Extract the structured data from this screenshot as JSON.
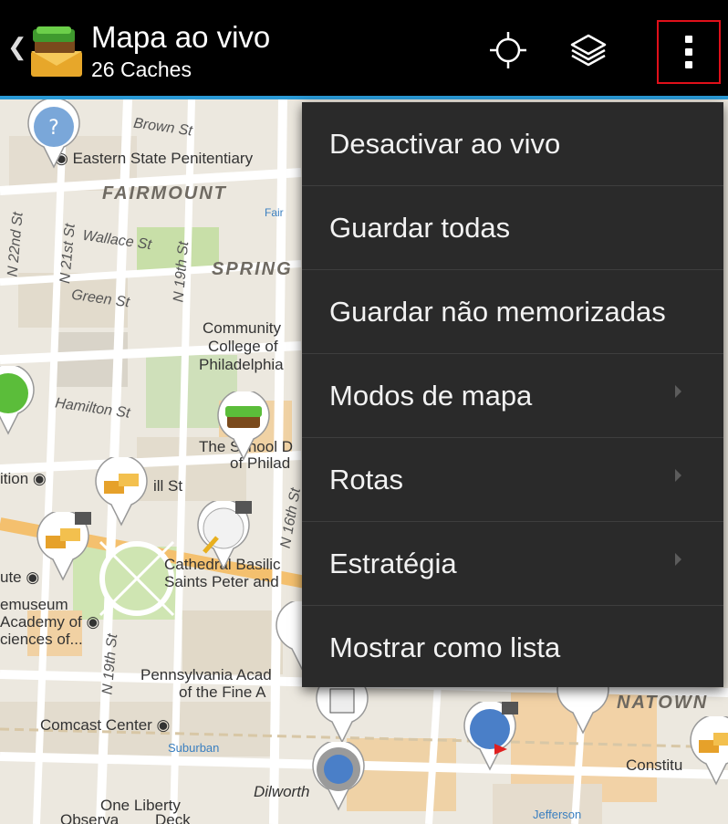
{
  "appbar": {
    "title": "Mapa ao vivo",
    "subtitle": "26 Caches",
    "icons": {
      "back": "back-chevron-icon",
      "logo": "app-logo-icon",
      "locate": "my-location-crosshair-icon",
      "layers": "layers-icon",
      "overflow": "more-vertical-icon"
    },
    "colors": {
      "background": "#000000",
      "accent": "#2a9ad6",
      "highlight_box": "#e0101a"
    }
  },
  "menu": {
    "items": [
      {
        "label": "Desactivar ao vivo",
        "has_submenu": false
      },
      {
        "label": "Guardar todas",
        "has_submenu": false
      },
      {
        "label": "Guardar não memorizadas",
        "has_submenu": false
      },
      {
        "label": "Modos de mapa",
        "has_submenu": true
      },
      {
        "label": "Rotas",
        "has_submenu": true
      },
      {
        "label": "Estratégia",
        "has_submenu": true
      },
      {
        "label": "Mostrar como lista",
        "has_submenu": false
      }
    ]
  },
  "map": {
    "streets": [
      "Brown St",
      "Wallace St",
      "N 22nd St",
      "N 21st St",
      "N 19th St",
      "Green St",
      "Hamilton St",
      "N 16th St",
      "N 19th St"
    ],
    "districts": [
      "FAIRMOUNT",
      "SPRING",
      "NATOWN"
    ],
    "pois": [
      "Eastern State Penitentiary",
      "Community",
      "College of",
      "Philadelphia",
      "The School D",
      "of Philad",
      "ition",
      "ill St",
      "ute",
      "Cathedral Basilic",
      "Saints Peter and",
      "emuseum",
      "Academy of",
      "ciences of...",
      "Pennsylvania Acad",
      "of the Fine A",
      "Comcast Center",
      "Suburban",
      "Dilworth",
      "One Liberty",
      "Observa",
      "Deck",
      "Jefferson",
      "Constitu",
      "Fair"
    ]
  }
}
